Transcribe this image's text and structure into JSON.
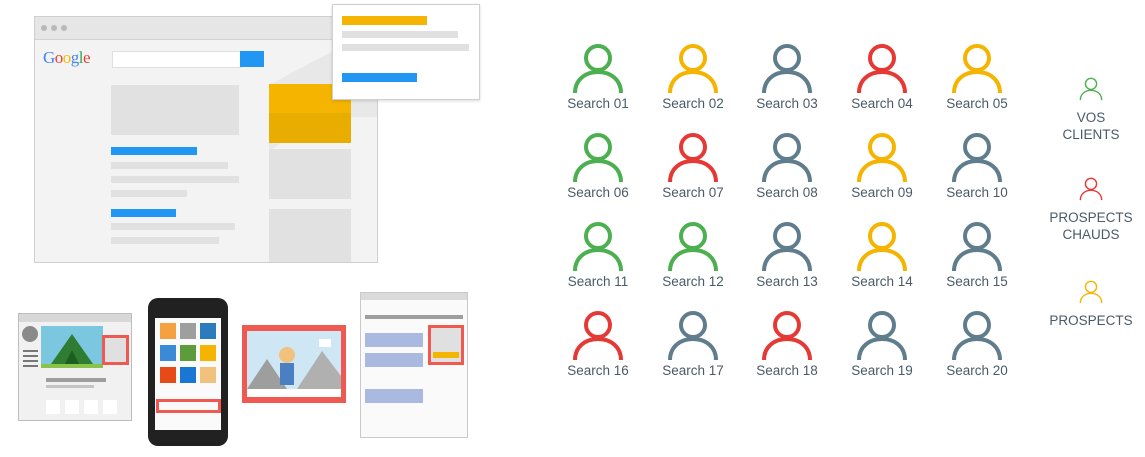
{
  "illustration": {
    "logo_text": "Google",
    "logo_colors": [
      "#4285f4",
      "#ea4335",
      "#fbbc05",
      "#4285f4",
      "#34a853",
      "#ea4335"
    ]
  },
  "colors": {
    "green": "#4caf50",
    "red": "#e53935",
    "yellow": "#f4b400",
    "gray": "#5f7d8c",
    "accent_blue": "#2196f3",
    "ad_red": "#ee5a52",
    "ad_yellow": "#f4b400"
  },
  "searches": [
    {
      "label": "Search 01",
      "color": "green"
    },
    {
      "label": "Search 02",
      "color": "yellow"
    },
    {
      "label": "Search 03",
      "color": "gray"
    },
    {
      "label": "Search 04",
      "color": "red"
    },
    {
      "label": "Search 05",
      "color": "yellow"
    },
    {
      "label": "Search 06",
      "color": "green"
    },
    {
      "label": "Search 07",
      "color": "red"
    },
    {
      "label": "Search 08",
      "color": "gray"
    },
    {
      "label": "Search 09",
      "color": "yellow"
    },
    {
      "label": "Search 10",
      "color": "gray"
    },
    {
      "label": "Search 11",
      "color": "green"
    },
    {
      "label": "Search 12",
      "color": "green"
    },
    {
      "label": "Search 13",
      "color": "gray"
    },
    {
      "label": "Search 14",
      "color": "yellow"
    },
    {
      "label": "Search 15",
      "color": "gray"
    },
    {
      "label": "Search 16",
      "color": "red"
    },
    {
      "label": "Search 17",
      "color": "gray"
    },
    {
      "label": "Search 18",
      "color": "red"
    },
    {
      "label": "Search 19",
      "color": "gray"
    },
    {
      "label": "Search 20",
      "color": "gray"
    }
  ],
  "legend": [
    {
      "lines": [
        "VOS",
        "CLIENTS"
      ],
      "color": "green"
    },
    {
      "lines": [
        "PROSPECTS",
        "CHAUDS"
      ],
      "color": "red"
    },
    {
      "lines": [
        "PROSPECTS"
      ],
      "color": "yellow"
    }
  ]
}
